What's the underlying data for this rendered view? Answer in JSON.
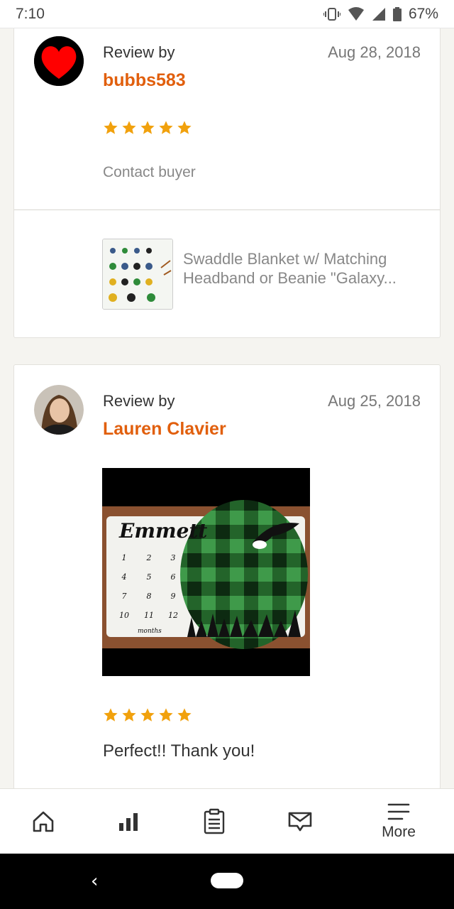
{
  "status_bar": {
    "time": "7:10",
    "battery": "67%"
  },
  "reviews": [
    {
      "review_by_label": "Review by",
      "reviewer": "bubbs583",
      "date": "Aug 28, 2018",
      "rating": 5,
      "contact_label": "Contact buyer",
      "item_title": "Swaddle Blanket w/ Matching Headband or Beanie \"Galaxy..."
    },
    {
      "review_by_label": "Review by",
      "reviewer": "Lauren Clavier",
      "date": "Aug 25, 2018",
      "rating": 5,
      "photo": {
        "name_text": "Emmett",
        "months": [
          "1",
          "2",
          "3",
          "4",
          "5",
          "6",
          "7",
          "8",
          "9",
          "10",
          "11",
          "12"
        ],
        "footer_text": "months"
      },
      "text": "Perfect!! Thank you!"
    }
  ],
  "tab_bar": {
    "tabs": [
      {
        "icon": "home-icon",
        "label": ""
      },
      {
        "icon": "stats-icon",
        "label": ""
      },
      {
        "icon": "orders-icon",
        "label": ""
      },
      {
        "icon": "messages-icon",
        "label": ""
      },
      {
        "icon": "menu-icon",
        "label": "More"
      }
    ]
  },
  "colors": {
    "accent": "#e15f0d",
    "star": "#f1a10d",
    "background": "#f5f4f0"
  }
}
